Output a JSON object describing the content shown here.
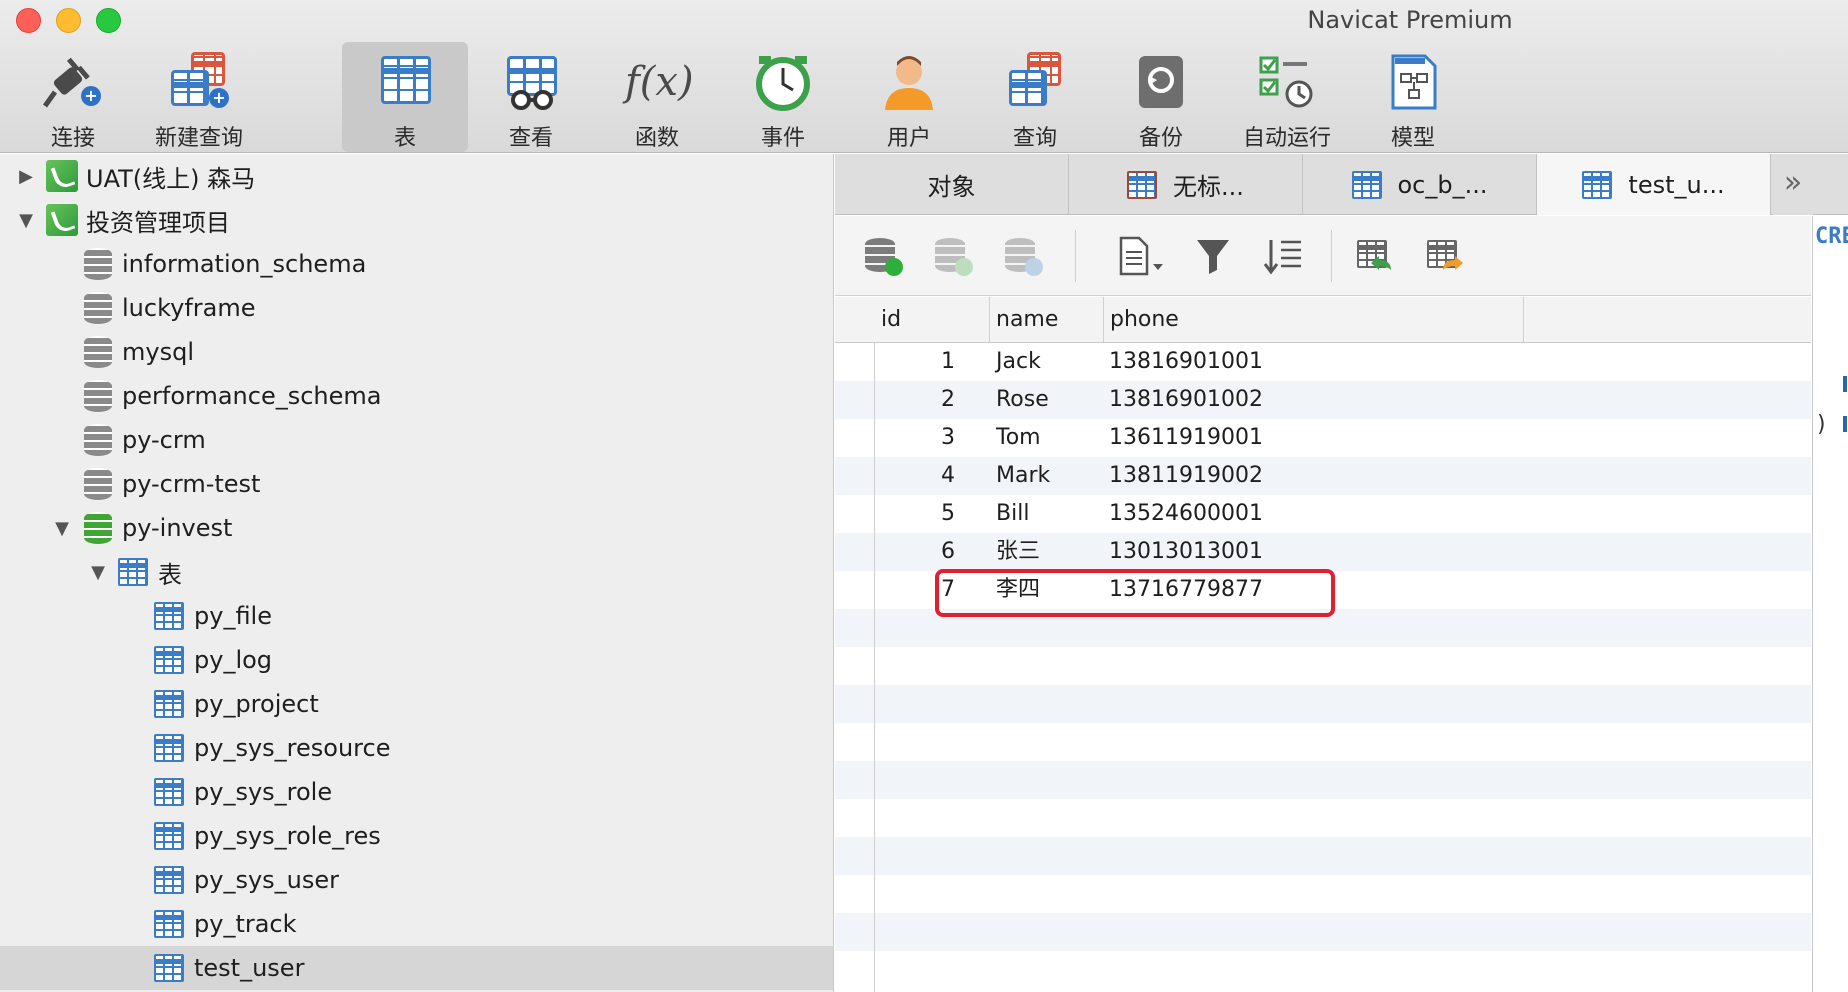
{
  "window": {
    "title": "Navicat Premium"
  },
  "toolbar": {
    "items": [
      {
        "label": "连接",
        "icon": "plug-icon"
      },
      {
        "label": "新建查询",
        "icon": "new-query-icon"
      },
      {
        "label": "表",
        "icon": "table-icon",
        "active": true
      },
      {
        "label": "查看",
        "icon": "view-icon"
      },
      {
        "label": "函数",
        "icon": "function-icon"
      },
      {
        "label": "事件",
        "icon": "clock-icon"
      },
      {
        "label": "用户",
        "icon": "user-icon"
      },
      {
        "label": "查询",
        "icon": "query-icon"
      },
      {
        "label": "备份",
        "icon": "backup-icon"
      },
      {
        "label": "自动运行",
        "icon": "automation-icon"
      },
      {
        "label": "模型",
        "icon": "model-icon"
      }
    ],
    "function_glyph": "f(x)"
  },
  "sidebar": {
    "connections": [
      {
        "label": "UAT(线上) 森马",
        "expanded": false
      },
      {
        "label": "投资管理项目",
        "expanded": true
      }
    ],
    "databases": [
      {
        "label": "information_schema"
      },
      {
        "label": "luckyframe"
      },
      {
        "label": "mysql"
      },
      {
        "label": "performance_schema"
      },
      {
        "label": "py-crm"
      },
      {
        "label": "py-crm-test"
      },
      {
        "label": "py-invest",
        "open": true
      }
    ],
    "tables_group": "表",
    "tables": [
      {
        "label": "py_file"
      },
      {
        "label": "py_log"
      },
      {
        "label": "py_project"
      },
      {
        "label": "py_sys_resource"
      },
      {
        "label": "py_sys_role"
      },
      {
        "label": "py_sys_role_res"
      },
      {
        "label": "py_sys_user"
      },
      {
        "label": "py_track"
      },
      {
        "label": "test_user",
        "selected": true
      }
    ]
  },
  "tabs": [
    {
      "label": "对象"
    },
    {
      "label": "无标..."
    },
    {
      "label": "oc_b_..."
    },
    {
      "label": "test_u...",
      "active": true
    }
  ],
  "grid": {
    "columns": [
      "id",
      "name",
      "phone"
    ],
    "rows": [
      {
        "id": "1",
        "name": "Jack",
        "phone": "13816901001"
      },
      {
        "id": "2",
        "name": "Rose",
        "phone": "13816901002"
      },
      {
        "id": "3",
        "name": "Tom",
        "phone": "13611919001"
      },
      {
        "id": "4",
        "name": "Mark",
        "phone": "13811919002"
      },
      {
        "id": "5",
        "name": "Bill",
        "phone": "13524600001"
      },
      {
        "id": "6",
        "name": "张三",
        "phone": "13013013001"
      },
      {
        "id": "7",
        "name": "李四",
        "phone": "13716779877"
      }
    ],
    "highlighted_row": 7,
    "highlight_color": "#e0202f"
  },
  "ddl": {
    "text": "CRE",
    "closing": ")"
  },
  "colors": {
    "accent": "#3a7cc6",
    "green": "#2fae3c"
  }
}
